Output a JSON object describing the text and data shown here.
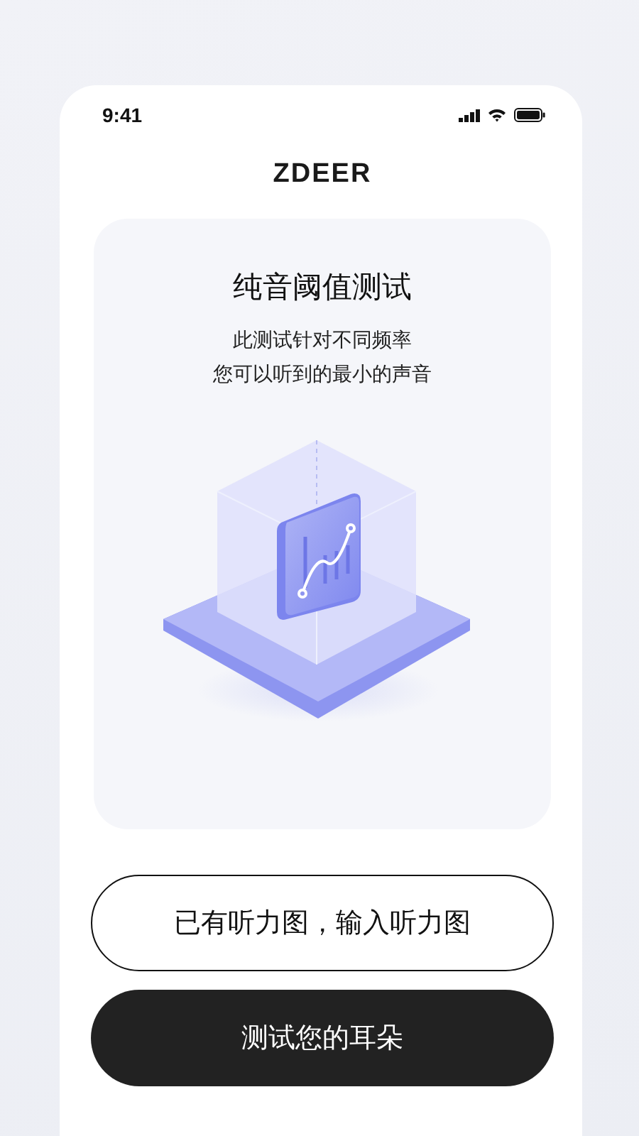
{
  "status_bar": {
    "time": "9:41"
  },
  "app_title": "ZDEER",
  "intro_card": {
    "title": "纯音阈值测试",
    "description": [
      "此测试针对不同频率",
      "您可以听到的最小的声音"
    ]
  },
  "buttons": [
    {
      "label": "已有听力图，输入听力图",
      "kind": "outline"
    },
    {
      "label": "测试您的耳朵",
      "kind": "filled"
    }
  ]
}
